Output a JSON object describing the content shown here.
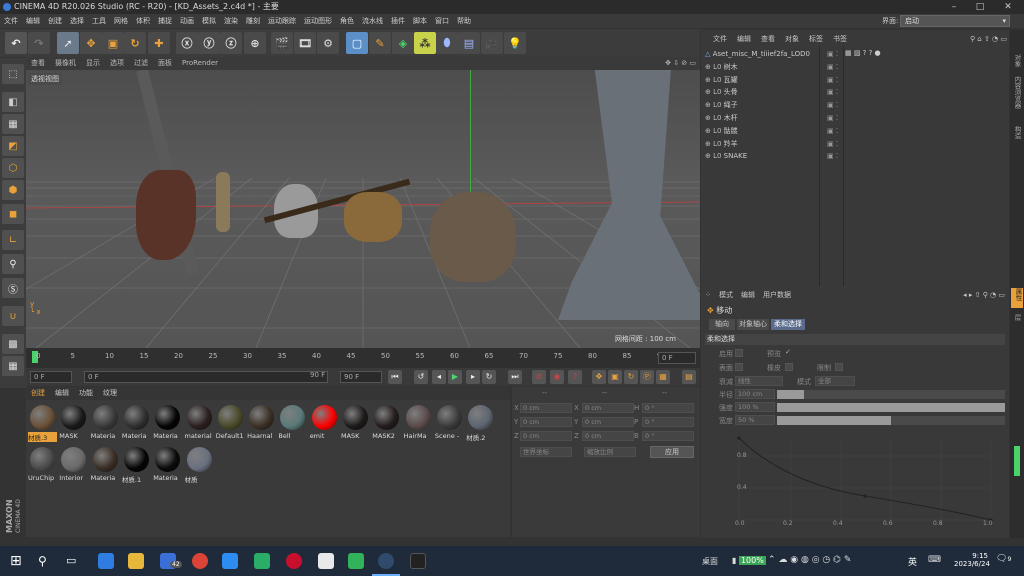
{
  "window": {
    "title": "CINEMA 4D R20.026 Studio (RC - R20) - [KD_Assets_2.c4d *] - 主要",
    "controls": [
      "–",
      "□",
      "✕"
    ]
  },
  "menu": [
    "文件",
    "编辑",
    "创建",
    "选择",
    "工具",
    "网格",
    "体积",
    "捕捉",
    "动画",
    "模拟",
    "渲染",
    "雕刻",
    "运动跟踪",
    "运动图形",
    "角色",
    "流水线",
    "插件",
    "脚本",
    "窗口",
    "帮助"
  ],
  "layout": {
    "label": "界面:",
    "value": "启动"
  },
  "viewport": {
    "tabs": [
      "查看",
      "摄像机",
      "显示",
      "选项",
      "过滤",
      "面板",
      "ProRender"
    ],
    "label": "透视视图",
    "grid_info": "网格间距 : 100 cm"
  },
  "timeline": {
    "ticks": [
      "0",
      "5",
      "10",
      "15",
      "20",
      "25",
      "30",
      "35",
      "40",
      "45",
      "50",
      "55",
      "60",
      "65",
      "70",
      "75",
      "80",
      "85",
      "90"
    ],
    "end_frame": "0 F",
    "start": "0 F",
    "start2": "0 F",
    "max": "90 F",
    "max2": "90 F"
  },
  "materials": {
    "tabs": [
      "创建",
      "编辑",
      "功能",
      "纹理"
    ],
    "row1": [
      {
        "name": "材质.3",
        "color": "#6b5138",
        "selected": true
      },
      {
        "name": "MASK",
        "color": "#1a1a1a"
      },
      {
        "name": "Materia",
        "color": "#3a3a3a"
      },
      {
        "name": "Materia",
        "color": "#2f2f2f"
      },
      {
        "name": "Materia",
        "color": "#050505"
      },
      {
        "name": "material",
        "color": "#2b2020"
      },
      {
        "name": "Default1",
        "color": "#4a4a2a"
      },
      {
        "name": "Haarnal",
        "color": "#3a3025"
      },
      {
        "name": "Bell",
        "color": "#5a7a7a"
      },
      {
        "name": "emit",
        "color": "#ff0000"
      },
      {
        "name": "MASK",
        "color": "#1e1a1a"
      },
      {
        "name": "MASK2",
        "color": "#241c1c"
      },
      {
        "name": "HairMa",
        "color": "#5a4a4a"
      },
      {
        "name": "Scene -",
        "color": "#3b3b3b"
      },
      {
        "name": "材质.2",
        "color": "#5d6570"
      }
    ],
    "row2": [
      {
        "name": "UruChip",
        "color": "#4a4a4a"
      },
      {
        "name": "Interior",
        "color": "#6a6a6a"
      },
      {
        "name": "Materia",
        "color": "#3a2e25"
      },
      {
        "name": "材质.1",
        "color": "#050505"
      },
      {
        "name": "Materia",
        "color": "#0a0a0a"
      },
      {
        "name": "材质",
        "color": "#6a7080"
      }
    ]
  },
  "coords": {
    "headers": [
      "--",
      "--",
      "--"
    ],
    "rows": [
      {
        "a": "X",
        "av": "0 cm",
        "b": "X",
        "bv": "0 cm",
        "c": "H",
        "cv": "0 °"
      },
      {
        "a": "Y",
        "av": "0 cm",
        "b": "Y",
        "bv": "0 cm",
        "c": "P",
        "cv": "0 °"
      },
      {
        "a": "Z",
        "av": "0 cm",
        "b": "Z",
        "bv": "0 cm",
        "c": "B",
        "cv": "0 °"
      }
    ],
    "mode1": "世界坐标",
    "mode2": "缩放比例",
    "apply": "应用"
  },
  "object_manager": {
    "tabs": [
      "文件",
      "编辑",
      "查看",
      "对象",
      "标签",
      "书签"
    ],
    "objects": [
      "Aset_misc_M_tiiief2fa_LOD0",
      "树木",
      "瓦罐",
      "头骨",
      "绳子",
      "木杆",
      "骷髅",
      "羚羊",
      "SNAKE"
    ]
  },
  "attributes": {
    "tabs": [
      "模式",
      "编辑",
      "用户数据"
    ],
    "title": "移动",
    "subtabs": [
      "轴向",
      "对象轴心",
      "柔和选择"
    ],
    "section": "柔和选择",
    "rows": [
      {
        "l": "启用",
        "l2": "预览"
      },
      {
        "l": "表面",
        "l2": "橡皮",
        "l3": "限制"
      },
      {
        "l": "衰减",
        "v": "线性",
        "l2": "模式",
        "v2": "全部"
      }
    ],
    "sliders": [
      {
        "l": "半径",
        "v": "100 cm",
        "fill": 0.12
      },
      {
        "l": "强度",
        "v": "100 %",
        "fill": 1.0
      },
      {
        "l": "宽度",
        "v": "50 %",
        "fill": 0.5
      }
    ],
    "curve_y": [
      "1",
      "0.8",
      "0.4"
    ],
    "curve_x": [
      "0.0",
      "0.2",
      "0.4",
      "0.6",
      "0.8",
      "1.0"
    ]
  },
  "right_strip": [
    "对象",
    "内容浏览器",
    "构造",
    "层",
    "属性"
  ],
  "branding": {
    "line1": "MAXON",
    "line2": "CINEMA 4D"
  },
  "taskbar": {
    "desktop": "桌面",
    "battery": "100%",
    "ime": "英",
    "time": "9:15",
    "date": "2023/6/24",
    "badge": "42",
    "notif": "9"
  }
}
